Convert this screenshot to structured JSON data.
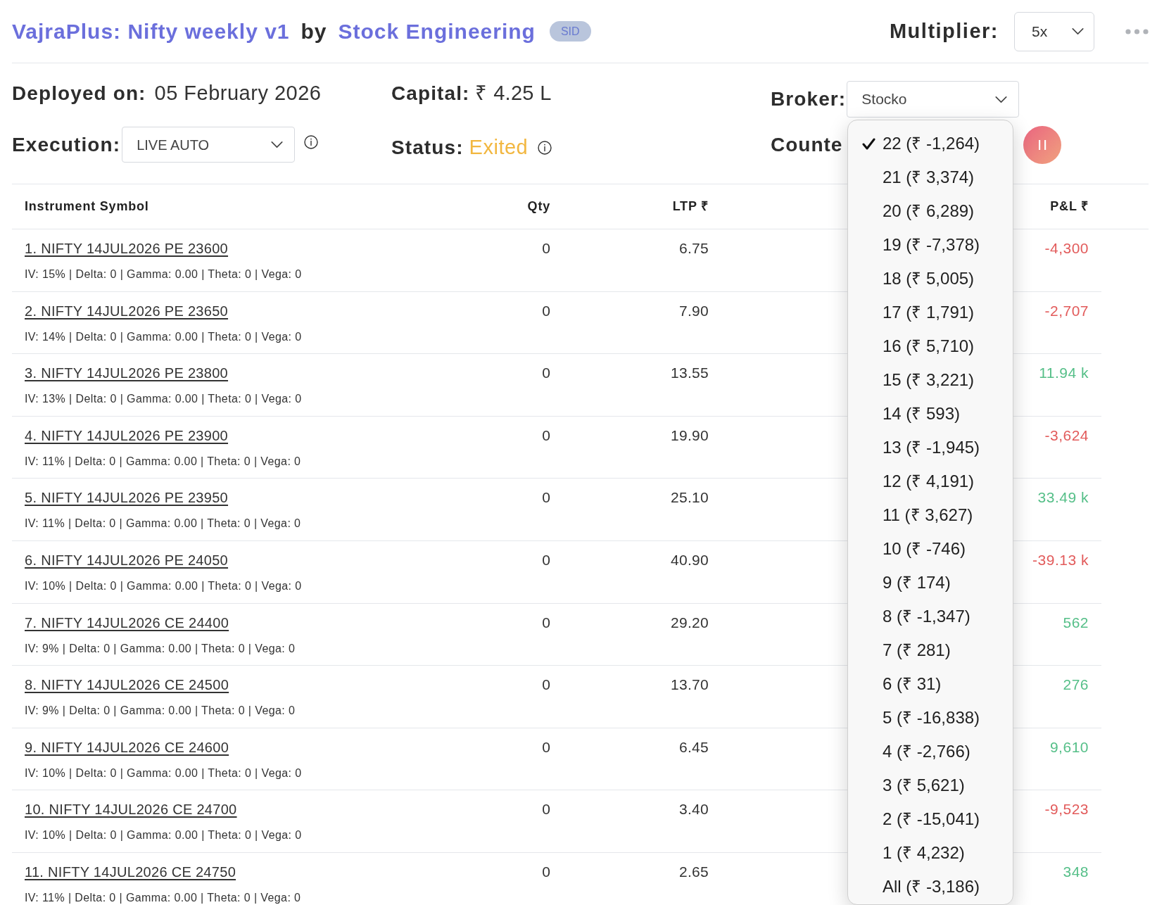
{
  "header": {
    "title": "VajraPlus: Nifty weekly v1",
    "by": "by",
    "author": "Stock Engineering",
    "badge": "SID",
    "multiplier": {
      "label": "Multiplier:",
      "value": "5x"
    }
  },
  "details": {
    "deployed": {
      "label": "Deployed on:",
      "value": "05 February 2026"
    },
    "capital": {
      "label": "Capital:",
      "value": "₹ 4.25 L"
    },
    "broker": {
      "label": "Broker:",
      "value": "Stocko"
    },
    "execution": {
      "label": "Execution:",
      "value": "LIVE AUTO"
    },
    "status": {
      "label": "Status:",
      "value": "Exited"
    },
    "counter": {
      "label": "Counte",
      "expanded": true,
      "options": [
        {
          "label": "22 (₹ -1,264)",
          "selected": true
        },
        {
          "label": "21 (₹ 3,374)",
          "selected": false
        },
        {
          "label": "20 (₹ 6,289)",
          "selected": false
        },
        {
          "label": "19 (₹ -7,378)",
          "selected": false
        },
        {
          "label": "18 (₹ 5,005)",
          "selected": false
        },
        {
          "label": "17 (₹ 1,791)",
          "selected": false
        },
        {
          "label": "16 (₹ 5,710)",
          "selected": false
        },
        {
          "label": "15 (₹ 3,221)",
          "selected": false
        },
        {
          "label": "14 (₹ 593)",
          "selected": false
        },
        {
          "label": "13 (₹ -1,945)",
          "selected": false
        },
        {
          "label": "12 (₹ 4,191)",
          "selected": false
        },
        {
          "label": "11 (₹ 3,627)",
          "selected": false
        },
        {
          "label": "10 (₹ -746)",
          "selected": false
        },
        {
          "label": "9 (₹ 174)",
          "selected": false
        },
        {
          "label": "8 (₹ -1,347)",
          "selected": false
        },
        {
          "label": "7 (₹ 281)",
          "selected": false
        },
        {
          "label": "6 (₹ 31)",
          "selected": false
        },
        {
          "label": "5 (₹ -16,838)",
          "selected": false
        },
        {
          "label": "4 (₹ -2,766)",
          "selected": false
        },
        {
          "label": "3 (₹ 5,621)",
          "selected": false
        },
        {
          "label": "2 (₹ -15,041)",
          "selected": false
        },
        {
          "label": "1 (₹ 4,232)",
          "selected": false
        },
        {
          "label": "All (₹ -3,186)",
          "selected": false
        }
      ]
    }
  },
  "table": {
    "columns": [
      "Instrument Symbol",
      "Qty",
      "LTP ₹",
      "P&L ₹"
    ],
    "rows": [
      {
        "symbol": "1. NIFTY 14JUL2026 PE 23600",
        "greeks": "IV: 15% | Delta: 0 | Gamma: 0.00 | Theta: 0 | Vega: 0",
        "qty": "0",
        "ltp": "6.75",
        "pnl": "-4,300",
        "profit": false
      },
      {
        "symbol": "2. NIFTY 14JUL2026 PE 23650",
        "greeks": "IV: 14% | Delta: 0 | Gamma: 0.00 | Theta: 0 | Vega: 0",
        "qty": "0",
        "ltp": "7.90",
        "pnl": "-2,707",
        "profit": false
      },
      {
        "symbol": "3. NIFTY 14JUL2026 PE 23800",
        "greeks": "IV: 13% | Delta: 0 | Gamma: 0.00 | Theta: 0 | Vega: 0",
        "qty": "0",
        "ltp": "13.55",
        "pnl": "11.94 k",
        "profit": true
      },
      {
        "symbol": "4. NIFTY 14JUL2026 PE 23900",
        "greeks": "IV: 11% | Delta: 0 | Gamma: 0.00 | Theta: 0 | Vega: 0",
        "qty": "0",
        "ltp": "19.90",
        "pnl": "-3,624",
        "profit": false
      },
      {
        "symbol": "5. NIFTY 14JUL2026 PE 23950",
        "greeks": "IV: 11% | Delta: 0 | Gamma: 0.00 | Theta: 0 | Vega: 0",
        "qty": "0",
        "ltp": "25.10",
        "pnl": "33.49 k",
        "profit": true
      },
      {
        "symbol": "6. NIFTY 14JUL2026 PE 24050",
        "greeks": "IV: 10% | Delta: 0 | Gamma: 0.00 | Theta: 0 | Vega: 0",
        "qty": "0",
        "ltp": "40.90",
        "pnl": "-39.13 k",
        "profit": false
      },
      {
        "symbol": "7. NIFTY 14JUL2026 CE 24400",
        "greeks": "IV: 9% | Delta: 0 | Gamma: 0.00 | Theta: 0 | Vega: 0",
        "qty": "0",
        "ltp": "29.20",
        "pnl": "562",
        "profit": true
      },
      {
        "symbol": "8. NIFTY 14JUL2026 CE 24500",
        "greeks": "IV: 9% | Delta: 0 | Gamma: 0.00 | Theta: 0 | Vega: 0",
        "qty": "0",
        "ltp": "13.70",
        "pnl": "276",
        "profit": true
      },
      {
        "symbol": "9. NIFTY 14JUL2026 CE 24600",
        "greeks": "IV: 10% | Delta: 0 | Gamma: 0.00 | Theta: 0 | Vega: 0",
        "qty": "0",
        "ltp": "6.45",
        "pnl": "9,610",
        "profit": true
      },
      {
        "symbol": "10. NIFTY 14JUL2026 CE 24700",
        "greeks": "IV: 10% | Delta: 0 | Gamma: 0.00 | Theta: 0 | Vega: 0",
        "qty": "0",
        "ltp": "3.40",
        "pnl": "-9,523",
        "profit": false
      },
      {
        "symbol": "11. NIFTY 14JUL2026 CE 24750",
        "greeks": "IV: 11% | Delta: 0 | Gamma: 0.00 | Theta: 0 | Vega: 0",
        "qty": "0",
        "ltp": "2.65",
        "pnl": "348",
        "profit": true
      }
    ]
  }
}
